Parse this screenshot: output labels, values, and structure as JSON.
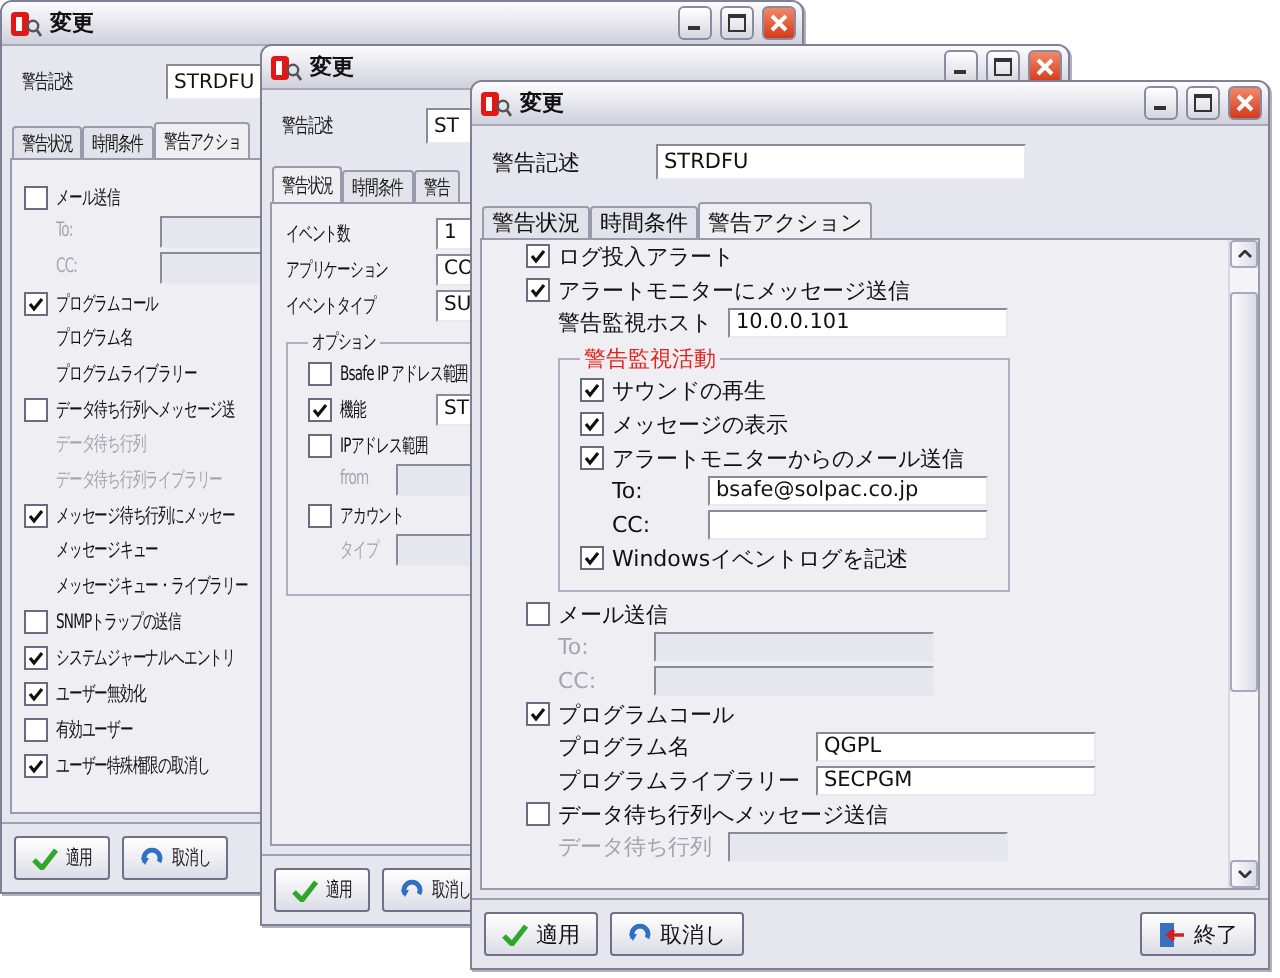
{
  "windows": [
    {
      "title": "変更",
      "description": {
        "label": "警告記述",
        "value": "STRDFU"
      },
      "tabs": [
        {
          "label": "警告状況",
          "selected": false
        },
        {
          "label": "時間条件",
          "selected": false
        },
        {
          "label": "警告アクショ",
          "selected": true
        }
      ],
      "items": [
        {
          "kind": "check",
          "label": "メール送信",
          "checked": false,
          "children": [
            {
              "kind": "field",
              "label": "To:",
              "disabled": true
            },
            {
              "kind": "field",
              "label": "CC:",
              "disabled": true
            }
          ]
        },
        {
          "kind": "check",
          "label": "プログラムコール",
          "checked": true,
          "children": [
            {
              "kind": "text",
              "label": "プログラム名",
              "disabled": false
            },
            {
              "kind": "text",
              "label": "プログラムライブラリー",
              "disabled": false
            }
          ]
        },
        {
          "kind": "check",
          "label": "データ待ち行列へメッセージ送",
          "checked": false,
          "children": [
            {
              "kind": "text",
              "label": "データ待ち行列",
              "disabled": true
            },
            {
              "kind": "text",
              "label": "データ待ち行列ライブラリー",
              "disabled": true
            }
          ]
        },
        {
          "kind": "check",
          "label": "メッセージ待ち行列にメッセー",
          "checked": true,
          "children": [
            {
              "kind": "text",
              "label": "メッセージキュー",
              "disabled": false
            },
            {
              "kind": "text",
              "label": "メッセージキュー・ライブラリー",
              "disabled": false
            }
          ]
        },
        {
          "kind": "check",
          "label": "SNMPトラップの送信",
          "checked": false
        },
        {
          "kind": "check",
          "label": "システムジャーナルへエントリ",
          "checked": true
        },
        {
          "kind": "check",
          "label": "ユーザー無効化",
          "checked": true
        },
        {
          "kind": "check",
          "label": "有効ユーザー",
          "checked": false
        },
        {
          "kind": "check",
          "label": "ユーザー特殊権限の取消し",
          "checked": true
        }
      ],
      "buttons": [
        {
          "label": "適用",
          "kind": "apply"
        },
        {
          "label": "取消し",
          "kind": "cancel"
        }
      ]
    },
    {
      "title": "変更",
      "description": {
        "label": "警告記述",
        "value": "ST"
      },
      "tabs": [
        {
          "label": "警告状況",
          "selected": true
        },
        {
          "label": "時間条件",
          "selected": false
        },
        {
          "label": "警告",
          "selected": false
        }
      ],
      "items": [
        {
          "kind": "field",
          "label": "イベント数",
          "value": "1",
          "disabled": false
        },
        {
          "kind": "field",
          "label": "アプリケーション",
          "value": "CO",
          "disabled": false
        },
        {
          "kind": "field",
          "label": "イベントタイプ",
          "value": "SU",
          "disabled": false
        },
        {
          "kind": "group",
          "legend": "オプション",
          "alert": false,
          "items": [
            {
              "kind": "check",
              "label": "Bsafe IP アドレス範囲",
              "checked": false
            },
            {
              "kind": "check_field",
              "label": "機能",
              "checked": true,
              "value": "ST"
            },
            {
              "kind": "check",
              "label": "IPアドレス範囲",
              "checked": false,
              "children": [
                {
                  "kind": "field",
                  "label": "from",
                  "disabled": true
                }
              ]
            },
            {
              "kind": "check",
              "label": "アカウント",
              "checked": false,
              "children": [
                {
                  "kind": "field",
                  "label": "タイプ",
                  "disabled": true
                }
              ]
            }
          ]
        }
      ],
      "buttons": [
        {
          "label": "適用",
          "kind": "apply"
        },
        {
          "label": "取消し",
          "kind": "cancel"
        }
      ]
    },
    {
      "title": "変更",
      "description": {
        "label": "警告記述",
        "value": "STRDFU"
      },
      "tabs": [
        {
          "label": "警告状況",
          "selected": false
        },
        {
          "label": "時間条件",
          "selected": false
        },
        {
          "label": "警告アクション",
          "selected": true
        }
      ],
      "items": [
        {
          "kind": "check",
          "label": "ログ投入アラート",
          "checked": true
        },
        {
          "kind": "check",
          "label": "アラートモニターにメッセージ送信",
          "checked": true,
          "children": [
            {
              "kind": "field",
              "label": "警告監視ホスト",
              "value": "10.0.0.101",
              "disabled": false
            },
            {
              "kind": "group",
              "legend": "警告監視活動",
              "alert": true,
              "items": [
                {
                  "kind": "check",
                  "label": "サウンドの再生",
                  "checked": true
                },
                {
                  "kind": "check",
                  "label": "メッセージの表示",
                  "checked": true
                },
                {
                  "kind": "check",
                  "label": "アラートモニターからのメール送信",
                  "checked": true,
                  "children": [
                    {
                      "kind": "field",
                      "label": "To:",
                      "value": "bsafe@solpac.co.jp",
                      "disabled": false
                    },
                    {
                      "kind": "field",
                      "label": "CC:",
                      "disabled": false
                    }
                  ]
                },
                {
                  "kind": "check",
                  "label": "Windowsイベントログを記述",
                  "checked": true
                }
              ]
            }
          ]
        },
        {
          "kind": "check",
          "label": "メール送信",
          "checked": false,
          "children": [
            {
              "kind": "field",
              "label": "To:",
              "disabled": true
            },
            {
              "kind": "field",
              "label": "CC:",
              "disabled": true
            }
          ]
        },
        {
          "kind": "check",
          "label": "プログラムコール",
          "checked": true,
          "children": [
            {
              "kind": "field",
              "label": "プログラム名",
              "value": "QGPL",
              "disabled": false
            },
            {
              "kind": "field",
              "label": "プログラムライブラリー",
              "value": "SECPGM",
              "disabled": false
            }
          ]
        },
        {
          "kind": "check",
          "label": "データ待ち行列へメッセージ送信",
          "checked": false,
          "children": [
            {
              "kind": "field",
              "label": "データ待ち行列",
              "disabled": true
            }
          ]
        }
      ],
      "buttons": [
        {
          "label": "適用",
          "kind": "apply"
        },
        {
          "label": "取消し",
          "kind": "cancel"
        },
        {
          "label": "終了",
          "kind": "exit"
        }
      ]
    }
  ]
}
